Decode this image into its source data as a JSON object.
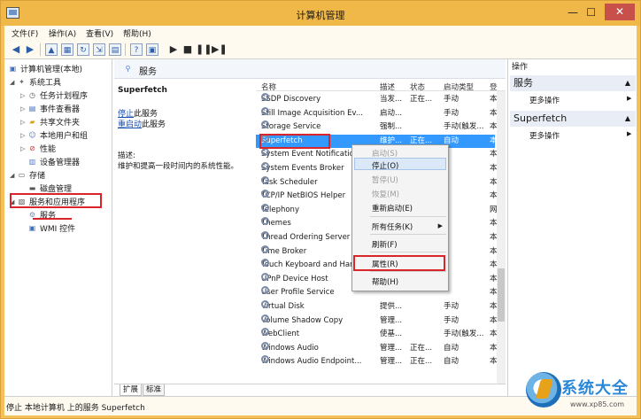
{
  "window": {
    "title": "计算机管理",
    "minimize": "—",
    "maximize": "☐",
    "close": "✕"
  },
  "menu": [
    "文件(F)",
    "操作(A)",
    "查看(V)",
    "帮助(H)"
  ],
  "toolbar": {
    "icons": [
      "back-arrow-icon",
      "forward-arrow-icon",
      "up-folder-icon",
      "console-tree-icon",
      "refresh-icon",
      "export-icon",
      "help-icon",
      "show-hide-icon",
      "play-icon",
      "stop-icon",
      "pause-icon",
      "restart-icon"
    ]
  },
  "tree": [
    {
      "label": "计算机管理(本地)",
      "icon": "computer-icon"
    },
    {
      "label": "系统工具",
      "icon": "tools-icon"
    },
    {
      "label": "任务计划程序",
      "icon": "clock-icon"
    },
    {
      "label": "事件查看器",
      "icon": "event-icon"
    },
    {
      "label": "共享文件夹",
      "icon": "folder-icon"
    },
    {
      "label": "本地用户和组",
      "icon": "users-icon"
    },
    {
      "label": "性能",
      "icon": "performance-icon"
    },
    {
      "label": "设备管理器",
      "icon": "device-icon"
    },
    {
      "label": "存储",
      "icon": "storage-icon"
    },
    {
      "label": "磁盘管理",
      "icon": "disk-icon"
    },
    {
      "label": "服务和应用程序",
      "icon": "services-apps-icon"
    },
    {
      "label": "服务",
      "icon": "gear-icon"
    },
    {
      "label": "WMI 控件",
      "icon": "wmi-icon"
    }
  ],
  "center": {
    "title": "服务"
  },
  "detail": {
    "name": "Superfetch",
    "stop_link": "停止",
    "stop_suffix": "此服务",
    "restart_link": "重启动",
    "restart_suffix": "此服务",
    "desc_label": "描述:",
    "desc_text": "维护和提高一段时间内的系统性能。"
  },
  "columns": [
    "名称",
    "描述",
    "状态",
    "启动类型",
    "登"
  ],
  "services": [
    {
      "name": "SSDP Discovery",
      "desc": "当发...",
      "status": "正在...",
      "startup": "手动",
      "logon": "本"
    },
    {
      "name": "Still Image Acquisition Ev...",
      "desc": "启动...",
      "status": "",
      "startup": "手动",
      "logon": "本"
    },
    {
      "name": "Storage Service",
      "desc": "强制...",
      "status": "",
      "startup": "手动(触发...",
      "logon": "本"
    },
    {
      "name": "Superfetch",
      "desc": "维护...",
      "status": "正在...",
      "startup": "自动",
      "logon": "本"
    },
    {
      "name": "System Event Notification Service",
      "desc": "",
      "status": "",
      "startup": "",
      "logon": "本"
    },
    {
      "name": "System Events Broker",
      "desc": "",
      "status": "",
      "startup": "",
      "logon": "本"
    },
    {
      "name": "Task Scheduler",
      "desc": "",
      "status": "",
      "startup": "",
      "logon": "本"
    },
    {
      "name": "TCP/IP NetBIOS Helper",
      "desc": "",
      "status": "",
      "startup": "",
      "logon": "本"
    },
    {
      "name": "Telephony",
      "desc": "",
      "status": "",
      "startup": "",
      "logon": "网"
    },
    {
      "name": "Themes",
      "desc": "",
      "status": "",
      "startup": "",
      "logon": "本"
    },
    {
      "name": "Thread Ordering Server",
      "desc": "",
      "status": "",
      "startup": "",
      "logon": "本"
    },
    {
      "name": "Time Broker",
      "desc": "",
      "status": "",
      "startup": "",
      "logon": "本"
    },
    {
      "name": "Touch Keyboard and Handwriting Panel Service",
      "desc": "",
      "status": "",
      "startup": "",
      "logon": "本"
    },
    {
      "name": "UPnP Device Host",
      "desc": "",
      "status": "",
      "startup": "",
      "logon": "本"
    },
    {
      "name": "User Profile Service",
      "desc": "",
      "status": "",
      "startup": "",
      "logon": "本"
    },
    {
      "name": "Virtual Disk",
      "desc": "提供...",
      "status": "",
      "startup": "手动",
      "logon": "本"
    },
    {
      "name": "Volume Shadow Copy",
      "desc": "管理...",
      "status": "",
      "startup": "手动",
      "logon": "本"
    },
    {
      "name": "WebClient",
      "desc": "使基...",
      "status": "",
      "startup": "手动(触发...",
      "logon": "本"
    },
    {
      "name": "Windows Audio",
      "desc": "管理...",
      "status": "正在...",
      "startup": "自动",
      "logon": "本"
    },
    {
      "name": "Windows Audio Endpoint...",
      "desc": "管理...",
      "status": "正在...",
      "startup": "自动",
      "logon": "本"
    }
  ],
  "context_menu": {
    "start": "启动(S)",
    "stop": "停止(O)",
    "pause": "暂停(U)",
    "resume": "恢复(M)",
    "restart": "重新启动(E)",
    "all_tasks": "所有任务(K)",
    "refresh": "刷新(F)",
    "properties": "属性(R)",
    "help": "帮助(H)"
  },
  "tabs": [
    "扩展",
    "标准"
  ],
  "actions": {
    "header": "操作",
    "sections": [
      {
        "title": "服务",
        "item": "更多操作"
      },
      {
        "title": "Superfetch",
        "item": "更多操作"
      }
    ]
  },
  "status": "停止 本地计算机 上的服务 Superfetch",
  "watermark": {
    "text": "系统大全",
    "url": "www.xp85.com"
  },
  "colors": {
    "title_bar": "#f0b849",
    "selection": "#3399ff",
    "highlight_box": "#d9252a",
    "close_button": "#c7504b",
    "link": "#1a4fb0"
  }
}
